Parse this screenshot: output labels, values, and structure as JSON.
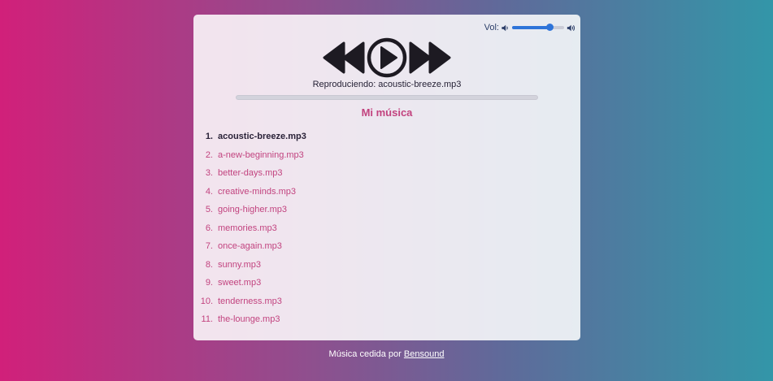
{
  "volume": {
    "label": "Vol:",
    "level": 0.73,
    "mute_icon": "volume-low-icon",
    "max_icon": "volume-high-icon",
    "accent_color": "#2e74d9"
  },
  "controls": {
    "prev_icon": "rewind-icon",
    "play_icon": "play-circle-icon",
    "next_icon": "fast-forward-icon"
  },
  "now_playing": {
    "text": "Reproduciendo: acoustic-breeze.mp3",
    "progress": 0
  },
  "playlist": {
    "title": "Mi música",
    "accent_color": "#c2437f",
    "tracks": [
      {
        "num": "1.",
        "name": "acoustic-breeze.mp3",
        "active": true
      },
      {
        "num": "2.",
        "name": "a-new-beginning.mp3",
        "active": false
      },
      {
        "num": "3.",
        "name": "better-days.mp3",
        "active": false
      },
      {
        "num": "4.",
        "name": "creative-minds.mp3",
        "active": false
      },
      {
        "num": "5.",
        "name": "going-higher.mp3",
        "active": false
      },
      {
        "num": "6.",
        "name": "memories.mp3",
        "active": false
      },
      {
        "num": "7.",
        "name": "once-again.mp3",
        "active": false
      },
      {
        "num": "8.",
        "name": "sunny.mp3",
        "active": false
      },
      {
        "num": "9.",
        "name": "sweet.mp3",
        "active": false
      },
      {
        "num": "10.",
        "name": "tenderness.mp3",
        "active": false
      },
      {
        "num": "11.",
        "name": "the-lounge.mp3",
        "active": false
      }
    ]
  },
  "footer": {
    "text": "Música cedida por",
    "link_text": "Bensound"
  }
}
